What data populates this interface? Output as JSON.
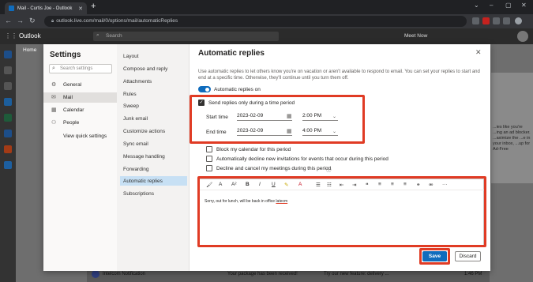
{
  "browser": {
    "tab_title": "Mail - Curtis Joe - Outlook",
    "url": "outlook.live.com/mail/0/options/mail/automaticReplies"
  },
  "outlook": {
    "brand": "Outlook",
    "search_placeholder": "Search",
    "home_tab": "Home",
    "meet_now": "Meet Now",
    "ad_text": "...ies like you're ...ing an ad blocker. ...aximize the ...e in your inbox, ...up for Ad-Free",
    "notification_sender": "Intelcom Notification",
    "notification_text": "Your package has been received!",
    "notification_preview": "Try our new feature: delivery ...",
    "notification_time": "1:46 PM"
  },
  "settings": {
    "title": "Settings",
    "search_placeholder": "Search settings",
    "categories": [
      {
        "label": "General",
        "icon": "gear-icon"
      },
      {
        "label": "Mail",
        "icon": "mail-icon"
      },
      {
        "label": "Calendar",
        "icon": "calendar-icon"
      },
      {
        "label": "People",
        "icon": "people-icon"
      }
    ],
    "view_quick_settings": "View quick settings",
    "subcategories": [
      "Layout",
      "Compose and reply",
      "Attachments",
      "Rules",
      "Sweep",
      "Junk email",
      "Customize actions",
      "Sync email",
      "Message handling",
      "Forwarding",
      "Automatic replies",
      "Subscriptions"
    ]
  },
  "auto_replies": {
    "title": "Automatic replies",
    "description": "Use automatic replies to let others know you're on vacation or aren't available to respond to email. You can set your replies to start and end at a specific time. Otherwise, they'll continue until you turn them off.",
    "toggle_label": "Automatic replies on",
    "toggle_on": true,
    "time_period_label": "Send replies only during a time period",
    "time_period_checked": true,
    "start_label": "Start time",
    "start_date": "2023-02-09",
    "start_time": "2:00 PM",
    "end_label": "End time",
    "end_date": "2023-02-09",
    "end_time": "4:00 PM",
    "block_calendar": "Block my calendar for this period",
    "auto_decline": "Automatically decline new invitations for events that occur during this period",
    "decline_cancel": "Decline and cancel my meetings during this period",
    "message": "Sorry, out for lunch, will be back in office ",
    "message_emph": "latecm",
    "save": "Save",
    "discard": "Discard"
  },
  "colors": {
    "accent": "#0f6cbd",
    "highlight_box": "#e03b24"
  }
}
